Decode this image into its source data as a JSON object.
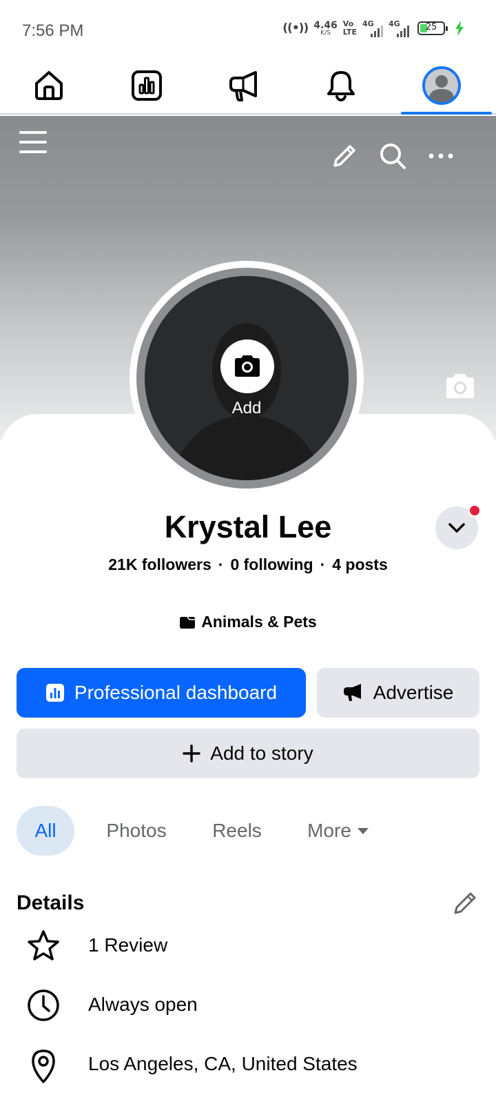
{
  "status_bar": {
    "time": "7:56 PM",
    "speed_value": "4.46",
    "speed_unit": "K/S",
    "volte_top": "Vo",
    "volte_bottom": "LTE",
    "net1": "4G",
    "net2": "4G",
    "battery": "25"
  },
  "nav": {
    "items": [
      {
        "name": "home-icon"
      },
      {
        "name": "dashboard-icon"
      },
      {
        "name": "megaphone-icon"
      },
      {
        "name": "bell-icon"
      },
      {
        "name": "profile-icon",
        "active": true
      }
    ]
  },
  "profile": {
    "avatar_add_label": "Add",
    "name": "Krystal Lee",
    "followers": "21K followers",
    "following": "0 following",
    "posts": "4 posts",
    "separator": "·",
    "category": "Animals & Pets"
  },
  "actions": {
    "dashboard_label": "Professional dashboard",
    "advertise_label": "Advertise",
    "story_label": "Add to story"
  },
  "tabs": [
    {
      "label": "All",
      "active": true
    },
    {
      "label": "Photos"
    },
    {
      "label": "Reels"
    },
    {
      "label": "More"
    }
  ],
  "details": {
    "title": "Details",
    "items": [
      {
        "icon": "star-icon",
        "text": "1 Review"
      },
      {
        "icon": "clock-icon",
        "text": "Always open"
      },
      {
        "icon": "location-pin-icon",
        "text": "Los Angeles, CA, United States"
      }
    ]
  },
  "colors": {
    "accent": "#0866ff",
    "button_gray": "#e4e6eb",
    "notification_dot": "#e41e3f",
    "active_tab_bg": "#dbe7f2"
  }
}
